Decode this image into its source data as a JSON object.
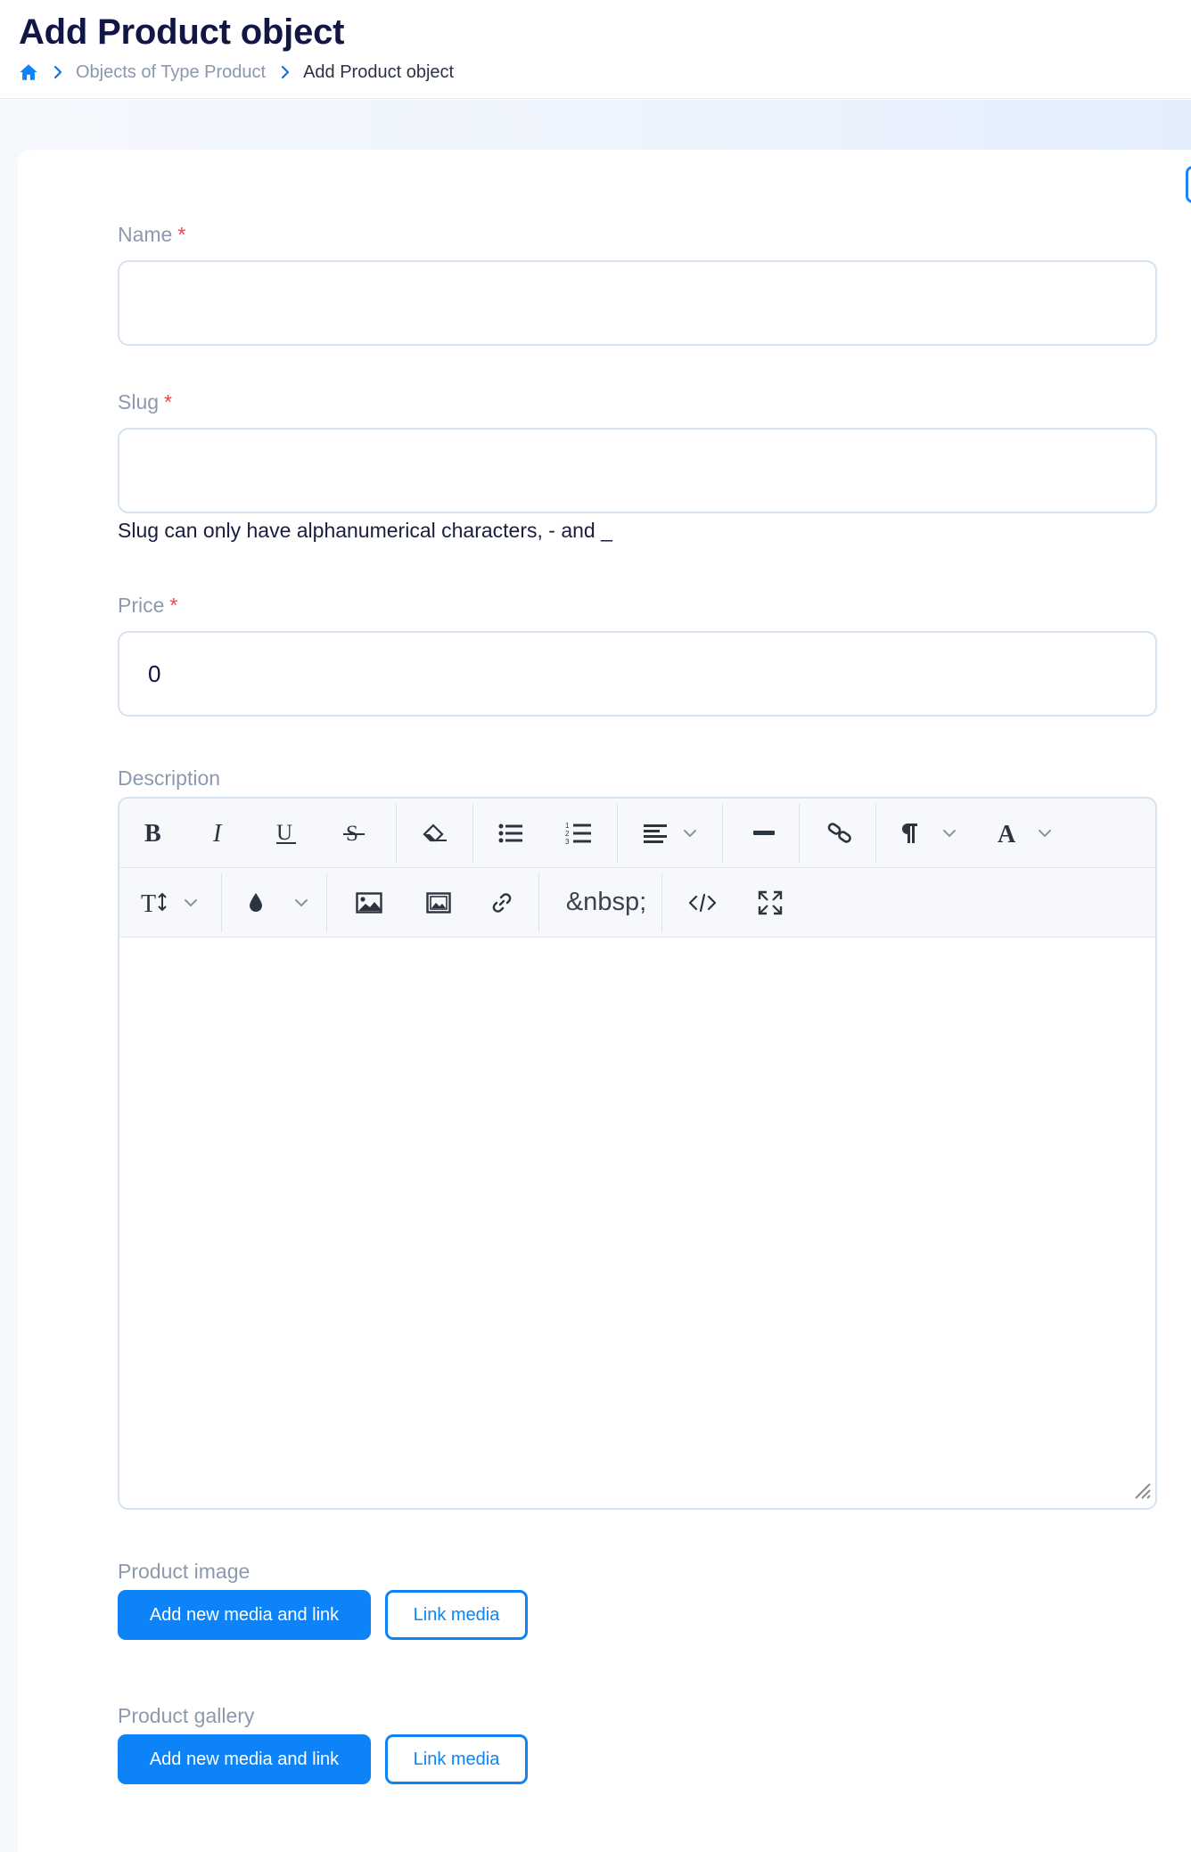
{
  "header": {
    "title": "Add Product object",
    "breadcrumb": {
      "home_icon": "home-icon",
      "items": [
        "Objects of Type Product",
        "Add Product object"
      ]
    }
  },
  "form": {
    "required_mark": "*",
    "name": {
      "label": "Name",
      "value": ""
    },
    "slug": {
      "label": "Slug",
      "value": "",
      "help": "Slug can only have alphanumerical characters, - and _"
    },
    "price": {
      "label": "Price",
      "value": "0"
    },
    "description": {
      "label": "Description",
      "toolbar_row1": [
        "bold-icon",
        "italic-icon",
        "underline-icon",
        "strikethrough-icon",
        "eraser-icon",
        "bullet-list-icon",
        "numbered-list-icon",
        "align-icon",
        "horizontal-rule-icon",
        "link-icon",
        "paragraph-icon",
        "font-icon"
      ],
      "toolbar_row2": [
        "font-size-icon",
        "color-drop-icon",
        "image-icon",
        "gallery-icon",
        "link-chain-icon",
        "nbsp",
        "code-view-icon",
        "fullscreen-icon"
      ],
      "nbsp_label": "&nbsp;"
    },
    "product_image": {
      "label": "Product image",
      "add_button": "Add new media and link",
      "link_button": "Link media"
    },
    "product_gallery": {
      "label": "Product gallery",
      "add_button": "Add new media and link",
      "link_button": "Link media"
    }
  },
  "colors": {
    "accent": "#0e83f7",
    "title": "#121645",
    "label": "#8c99ae",
    "required": "#e5484d"
  }
}
